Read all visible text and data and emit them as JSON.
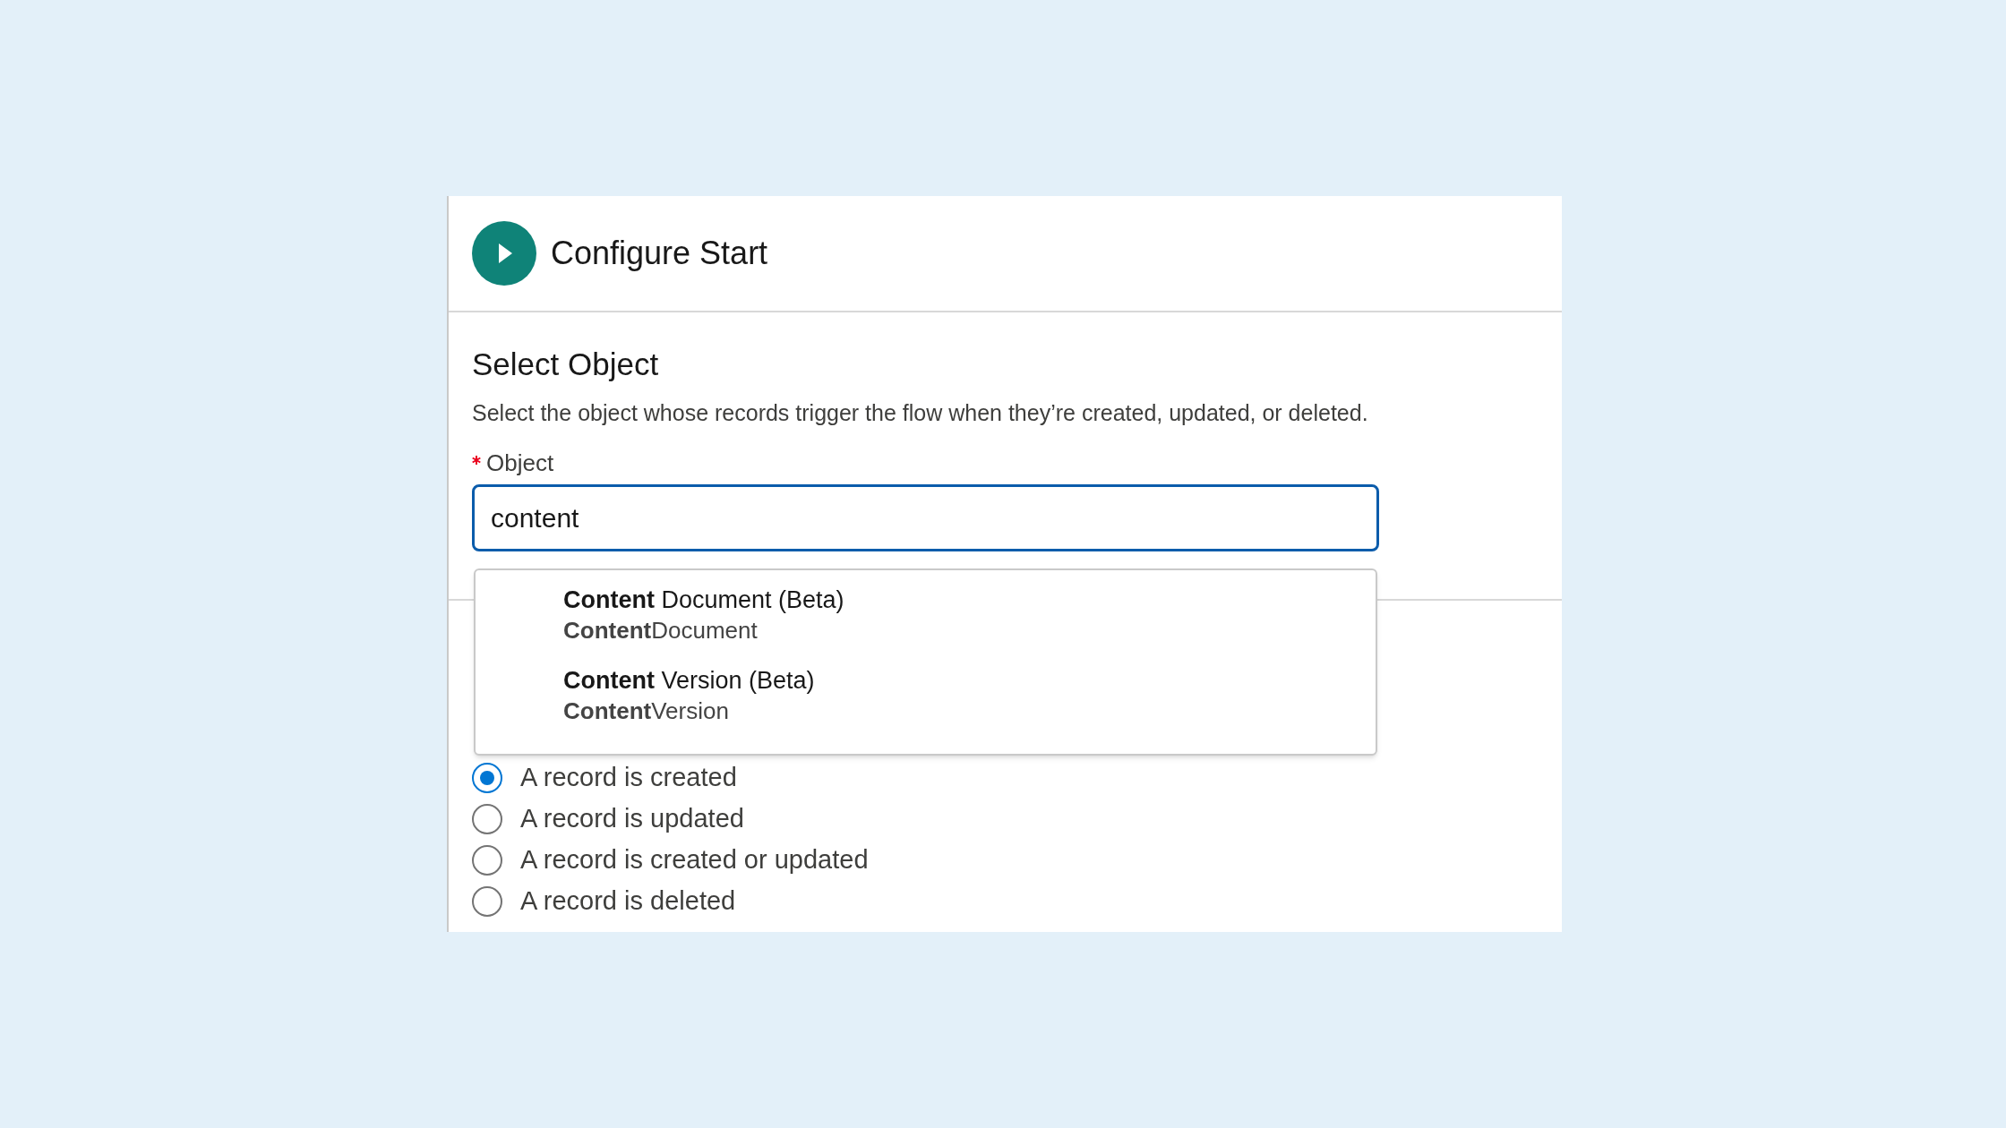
{
  "panel": {
    "title": "Configure Start"
  },
  "section": {
    "heading": "Select Object",
    "description": "Select the object whose records trigger the flow when they’re created, updated, or deleted.",
    "field": {
      "label": "Object",
      "required": true,
      "value": "content"
    }
  },
  "suggestions": [
    {
      "label": "**Content** Document (Beta)",
      "api_name": "**Content**Document"
    },
    {
      "label": "**Content** Version (Beta)",
      "api_name": "**Content**Version"
    }
  ],
  "trigger_options": [
    {
      "label": "A record is created",
      "selected": true
    },
    {
      "label": "A record is updated",
      "selected": false
    },
    {
      "label": "A record is created or updated",
      "selected": false
    },
    {
      "label": "A record is deleted",
      "selected": false
    }
  ]
}
